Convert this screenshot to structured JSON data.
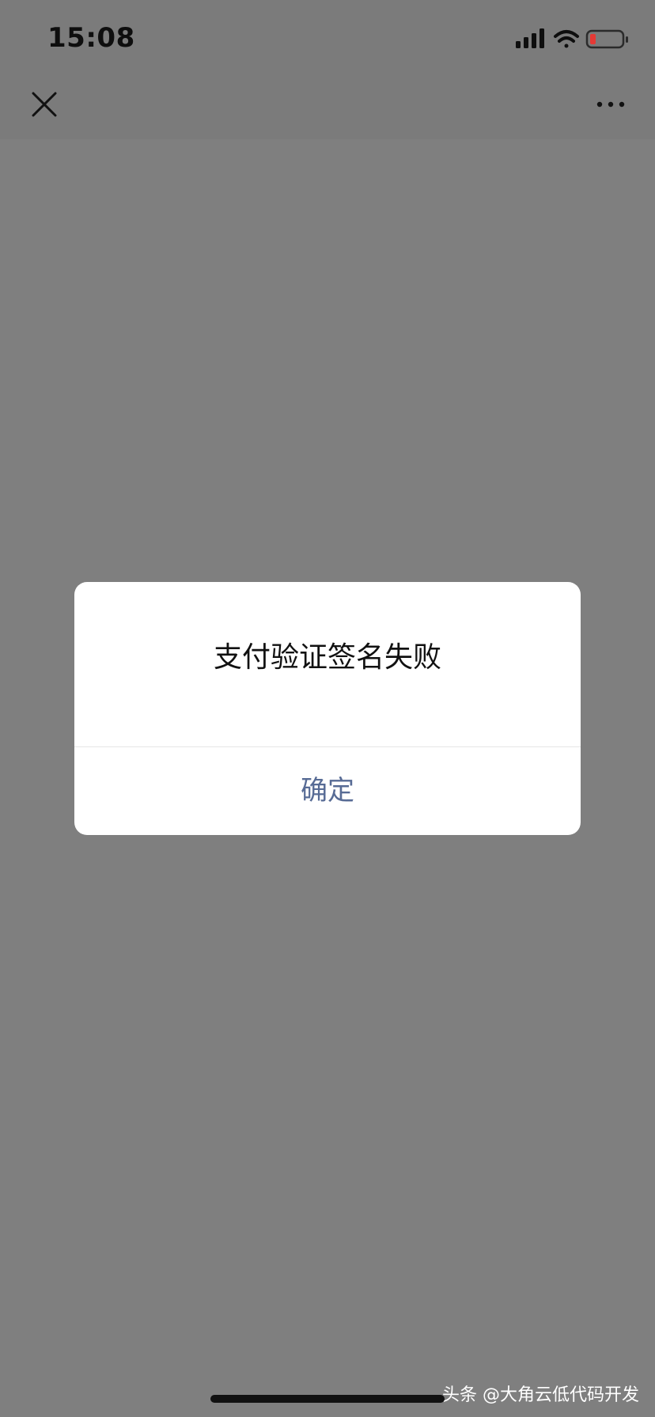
{
  "status_bar": {
    "time": "15:08",
    "icons": [
      "signal-icon",
      "wifi-icon",
      "battery-low-icon"
    ],
    "battery_color": "#e53935"
  },
  "nav": {
    "close_icon": "close-icon",
    "more_icon": "more-icon"
  },
  "dialog": {
    "message": "支付验证签名失败",
    "confirm_label": "确定",
    "confirm_color": "#576b95"
  },
  "watermark": {
    "text": "头条 @大角云低代码开发"
  }
}
